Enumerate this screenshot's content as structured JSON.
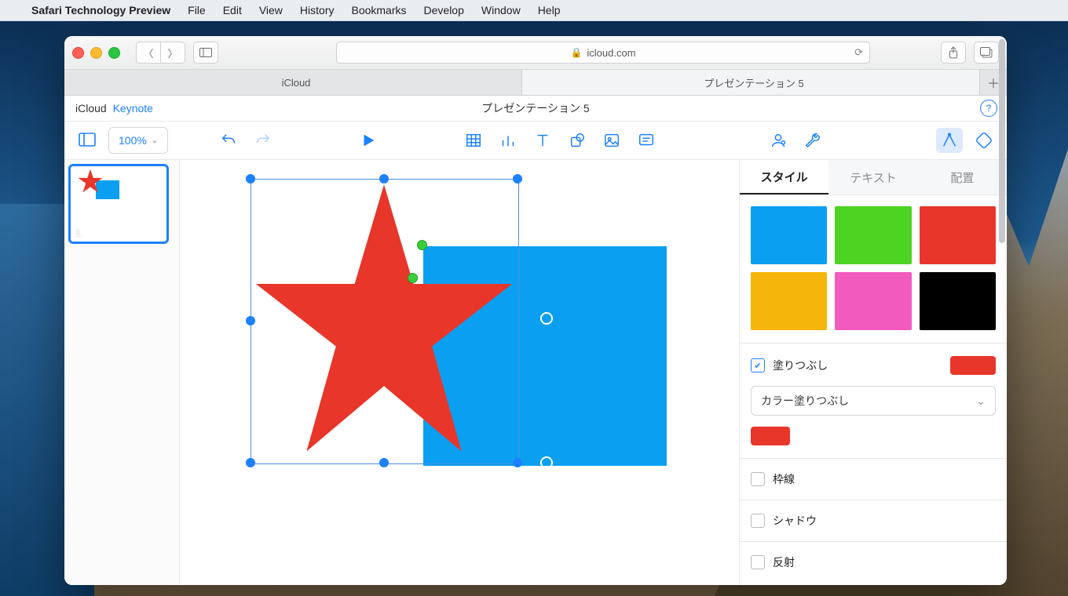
{
  "menubar": {
    "app": "Safari Technology Preview",
    "items": [
      "File",
      "Edit",
      "View",
      "History",
      "Bookmarks",
      "Develop",
      "Window",
      "Help"
    ]
  },
  "browser": {
    "url_display": "icloud.com",
    "tabs": [
      {
        "label": "iCloud",
        "active": false
      },
      {
        "label": "プレゼンテーション 5",
        "active": true
      }
    ]
  },
  "app": {
    "brand_left": "iCloud",
    "brand_right": "Keynote",
    "doc_title": "プレゼンテーション 5",
    "zoom": "100%",
    "slide_number": "1"
  },
  "inspector": {
    "tabs": [
      "スタイル",
      "テキスト",
      "配置"
    ],
    "style_colors": [
      "#0b9ff2",
      "#4dd321",
      "#e8362a",
      "#f6b50a",
      "#f05bbd",
      "#000000"
    ],
    "fill_label": "塗りつぶし",
    "fill_swatch": "#e8362a",
    "fill_type": "カラー塗りつぶし",
    "fill_color": "#e8362a",
    "border_label": "枠線",
    "shadow_label": "シャドウ",
    "reflection_label": "反射"
  },
  "shapes": {
    "rect_color": "#0b9ff2",
    "star_color": "#e8362a"
  }
}
